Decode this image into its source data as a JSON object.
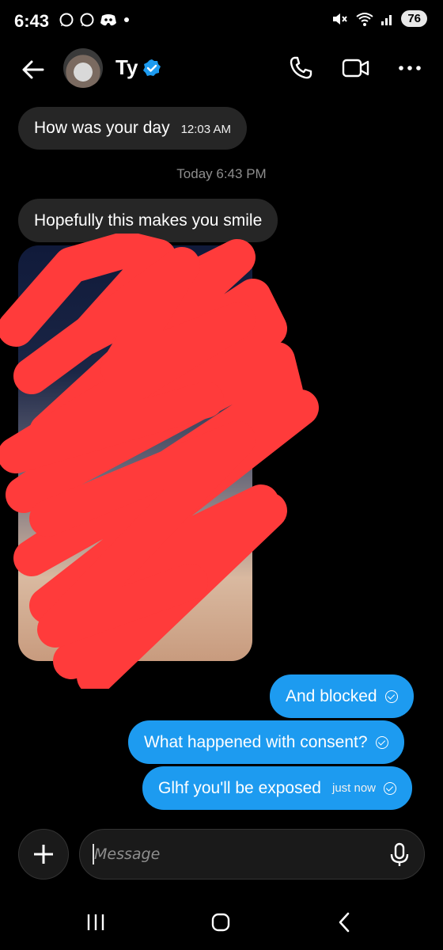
{
  "status_bar": {
    "time": "6:43",
    "battery": "76",
    "left_icons": [
      "chat-bubble-icon",
      "chat-bubble-icon",
      "discord-icon",
      "dot-icon"
    ],
    "right_icons": [
      "mute-icon",
      "wifi-icon",
      "signal-icon",
      "battery-icon"
    ]
  },
  "header": {
    "contact_name": "Ty",
    "verified": true,
    "accent_color": "#1d9bf0"
  },
  "messages": {
    "msg1_text": "How was your day",
    "msg1_time": "12:03 AM",
    "divider": "Today 6:43 PM",
    "msg2_text": "Hopefully this makes you smile",
    "sent1_text": "And blocked",
    "sent2_text": "What happened with consent?",
    "sent3_text": "Glhf you'll be exposed",
    "sent3_time": "just now"
  },
  "composer": {
    "placeholder": "Message"
  },
  "colors": {
    "sent_bubble": "#1d9bf0",
    "received_bubble": "#262626",
    "redaction": "#ff3b3b"
  }
}
